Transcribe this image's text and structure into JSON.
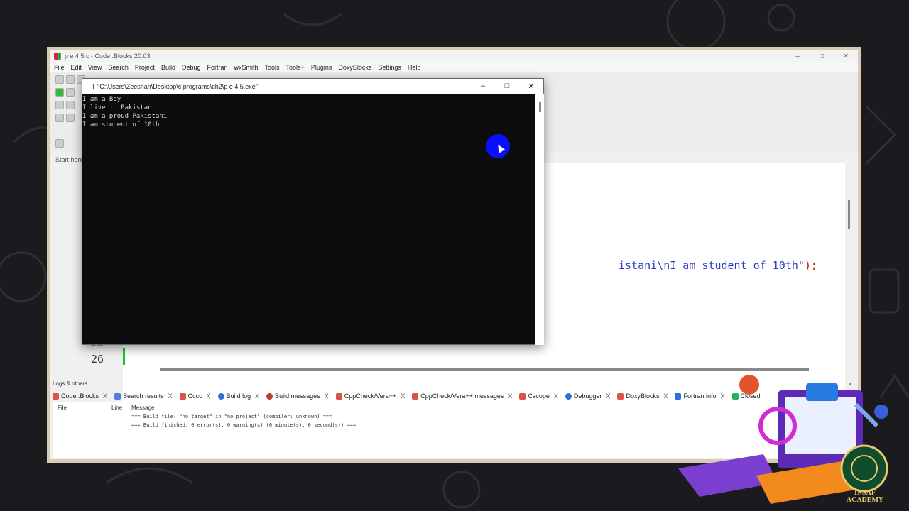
{
  "ide": {
    "title": "p e 4 5.c - Code::Blocks 20.03",
    "window_controls": [
      "–",
      "□",
      "✕"
    ],
    "menu": [
      "File",
      "Edit",
      "View",
      "Search",
      "Project",
      "Build",
      "Debug",
      "Fortran",
      "wxSmith",
      "Tools",
      "Tools+",
      "Plugins",
      "DoxyBlocks",
      "Settings",
      "Help"
    ],
    "start_here": "Start here",
    "code_visible": "istani\\nI am student of 10th\"",
    "code_end": ");",
    "line_numbers": [
      "25",
      "26"
    ]
  },
  "console": {
    "title": "\"C:\\Users\\Zeeshan\\Desktop\\c programs\\ch2\\p e 4 5.exe\"",
    "controls": [
      "–",
      "□",
      "✕"
    ],
    "lines": [
      "I am a Boy",
      "I live in Pakistan",
      "I am a proud Pakistani",
      "I am student of 10th"
    ]
  },
  "logs": {
    "title": "Logs & others",
    "close": "×",
    "tabs": [
      {
        "label": "Code::Blocks",
        "icon": "codeblocks-icon",
        "color": "#d9534f"
      },
      {
        "label": "Search results",
        "icon": "search-icon",
        "color": "#5a7bd6"
      },
      {
        "label": "Cccc",
        "icon": "document-icon",
        "color": "#d9534f"
      },
      {
        "label": "Build log",
        "icon": "gear-icon",
        "color": "#2a6fdb"
      },
      {
        "label": "Build messages",
        "icon": "pin-icon",
        "color": "#c0392b"
      },
      {
        "label": "CppCheck/Vera++",
        "icon": "document-icon",
        "color": "#d9534f"
      },
      {
        "label": "CppCheck/Vera++ messages",
        "icon": "document-icon",
        "color": "#d9534f"
      },
      {
        "label": "Cscope",
        "icon": "document-icon",
        "color": "#d9534f"
      },
      {
        "label": "Debugger",
        "icon": "gear-icon",
        "color": "#2a6fdb"
      },
      {
        "label": "DoxyBlocks",
        "icon": "document-icon",
        "color": "#d9534f"
      },
      {
        "label": "Fortran info",
        "icon": "fortran-icon",
        "color": "#2a6fdb"
      },
      {
        "label": "Closed",
        "icon": "closed-icon",
        "color": "#27ae60"
      }
    ],
    "tab_close": "X",
    "columns": [
      "File",
      "Line",
      "Message"
    ],
    "messages": [
      "=== Build file: \"no target\" in \"no project\" (compiler: unknown) ===",
      "=== Build finished: 0 error(s), 0 warning(s) (0 minute(s), 0 second(s)) ==="
    ]
  },
  "branding": {
    "name_line1": "INSAF",
    "name_line2": "ACADEMY"
  }
}
